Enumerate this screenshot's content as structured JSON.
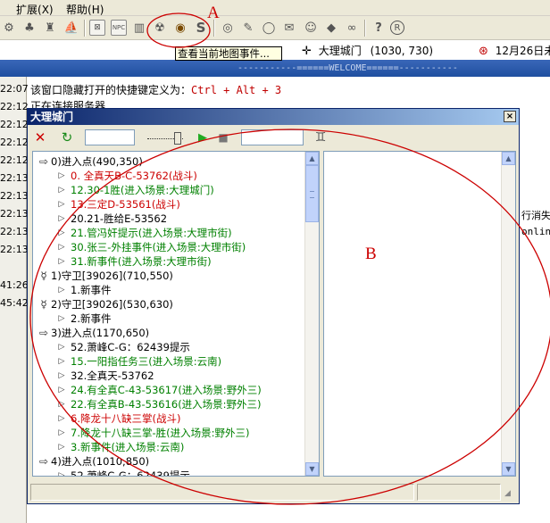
{
  "menu": {
    "expand": "扩展",
    "expand_key": "(X)",
    "help": "帮助",
    "help_key": "(H)"
  },
  "toolbar": {
    "tooltip": "查看当前地图事件...",
    "icons": [
      "pot-icon",
      "tree-icon",
      "tower-icon",
      "boat-icon",
      "npc-map-icon",
      "npc-icon",
      "book-icon",
      "monster-icon",
      "eye-icon",
      "script-icon",
      "target-icon",
      "wrench-icon",
      "circle-icon",
      "mail-icon",
      "mask-icon",
      "shield-icon",
      "chain-icon",
      "help-icon",
      "register-icon"
    ],
    "npc_map_label": "⊠",
    "npc_label": "NPC",
    "script_label": "S",
    "register_label": "R"
  },
  "current_location": {
    "map": "大理城门",
    "coords": "(1030, 730)",
    "date": "12月26日未"
  },
  "welcome_banner": "-----------======WELCOME======-----------",
  "log": {
    "times": [
      "22:07",
      "22:12",
      "22:12",
      "22:12",
      "22:12",
      "22:13",
      "22:13",
      "22:13",
      "22:13",
      "22:13",
      "41:26",
      "45:42"
    ],
    "line1_text": "该窗口隐藏打开的快捷键定义为：",
    "line1_key": "Ctrl + Alt + 3",
    "line2_text": "正在连接服务器",
    "right1": "行消失",
    "right2": "onlin"
  },
  "map_window": {
    "title": "大理城门",
    "close_label": "×",
    "tree": [
      {
        "level": 0,
        "icon": "enter-arrow-icon",
        "text": "0)进入点(490,350)",
        "color": "black"
      },
      {
        "level": 1,
        "icon": "triangle-icon",
        "text": "0. 全真天B-C-53762(战斗)",
        "color": "red"
      },
      {
        "level": 1,
        "icon": "triangle-icon",
        "text": "12.30-1胜(进入场景:大理城门)",
        "color": "green"
      },
      {
        "level": 1,
        "icon": "triangle-icon",
        "text": "13.三定D-53561(战斗)",
        "color": "red"
      },
      {
        "level": 1,
        "icon": "triangle-icon",
        "text": "20.21-胜给E-53562",
        "color": "black"
      },
      {
        "level": 1,
        "icon": "triangle-icon",
        "text": "21.管冯奸提示(进入场景:大理市街)",
        "color": "green"
      },
      {
        "level": 1,
        "icon": "triangle-icon",
        "text": "30.张三-外挂事件(进入场景:大理市街)",
        "color": "green"
      },
      {
        "level": 1,
        "icon": "triangle-icon",
        "text": "31.新事件(进入场景:大理市街)",
        "color": "green"
      },
      {
        "level": 0,
        "icon": "guard-icon",
        "text": "1)守卫[39026](710,550)",
        "color": "black"
      },
      {
        "level": 1,
        "icon": "triangle-icon",
        "text": "1.新事件",
        "color": "black"
      },
      {
        "level": 0,
        "icon": "guard-icon",
        "text": "2)守卫[39026](530,630)",
        "color": "black"
      },
      {
        "level": 1,
        "icon": "triangle-icon",
        "text": "2.新事件",
        "color": "black"
      },
      {
        "level": 0,
        "icon": "enter-arrow-icon",
        "text": "3)进入点(1170,650)",
        "color": "black"
      },
      {
        "level": 1,
        "icon": "triangle-icon",
        "text": "52.萧峰C-G：62439提示",
        "color": "black"
      },
      {
        "level": 1,
        "icon": "triangle-icon",
        "text": "15.一阳指任务三(进入场景:云南)",
        "color": "green"
      },
      {
        "level": 1,
        "icon": "triangle-icon",
        "text": "32.全真天-53762",
        "color": "black"
      },
      {
        "level": 1,
        "icon": "triangle-icon",
        "text": "24.有全真C-43-53617(进入场景:野外三)",
        "color": "green"
      },
      {
        "level": 1,
        "icon": "triangle-icon",
        "text": "22.有全真B-43-53616(进入场景:野外三)",
        "color": "green"
      },
      {
        "level": 1,
        "icon": "triangle-icon",
        "text": "6.降龙十八缺三掌(战斗)",
        "color": "red"
      },
      {
        "level": 1,
        "icon": "triangle-icon",
        "text": "7.降龙十八缺三掌-胜(进入场景:野外三)",
        "color": "green"
      },
      {
        "level": 1,
        "icon": "triangle-icon",
        "text": "3.新事件(进入场景:云南)",
        "color": "green"
      },
      {
        "level": 0,
        "icon": "enter-arrow-icon",
        "text": "4)进入点(1010,850)",
        "color": "black"
      },
      {
        "level": 1,
        "icon": "triangle-icon",
        "text": "52.萧峰C-G：62439提示",
        "color": "black"
      }
    ],
    "search_input_value": "",
    "filter_input_value": "",
    "scroll_up": "▲",
    "scroll_down": "▼"
  },
  "annotations": {
    "label_a": "A",
    "label_b": "B",
    "color": "#cc0000"
  }
}
